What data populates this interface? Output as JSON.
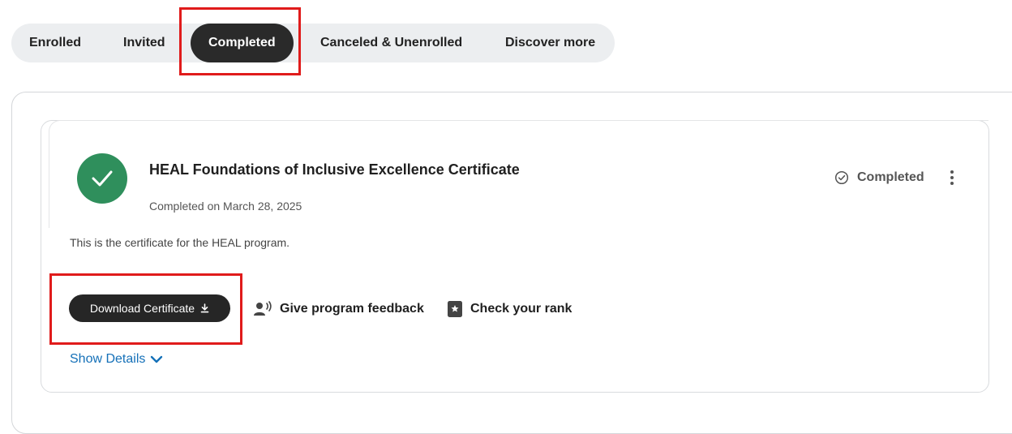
{
  "tabs": [
    {
      "label": "Enrolled"
    },
    {
      "label": "Invited"
    },
    {
      "label": "Completed"
    },
    {
      "label": "Canceled & Unenrolled"
    },
    {
      "label": "Discover more"
    }
  ],
  "active_tab": "Completed",
  "program": {
    "title": "HEAL Foundations of Inclusive Excellence Certificate",
    "completed_on": "Completed on March 28, 2025",
    "status": "Completed",
    "description": "This is the certificate for the HEAL program."
  },
  "actions": {
    "download_label": "Download Certificate",
    "feedback_label": "Give program feedback",
    "rank_label": "Check your rank",
    "show_details_label": "Show Details"
  },
  "icons": {
    "status_icon": "check-circle-outline-icon",
    "badge_icon": "check-icon",
    "download_icon": "download-icon",
    "feedback_icon": "speaking-person-icon",
    "rank_icon": "bookmark-star-icon",
    "details_icon": "chevron-down-icon",
    "menu_icon": "kebab-menu-icon"
  },
  "colors": {
    "success_green": "#2f8f5c",
    "active_tab_bg": "#2a2a2a",
    "link_blue": "#1470b8",
    "annotation_red": "#e01b1b"
  }
}
